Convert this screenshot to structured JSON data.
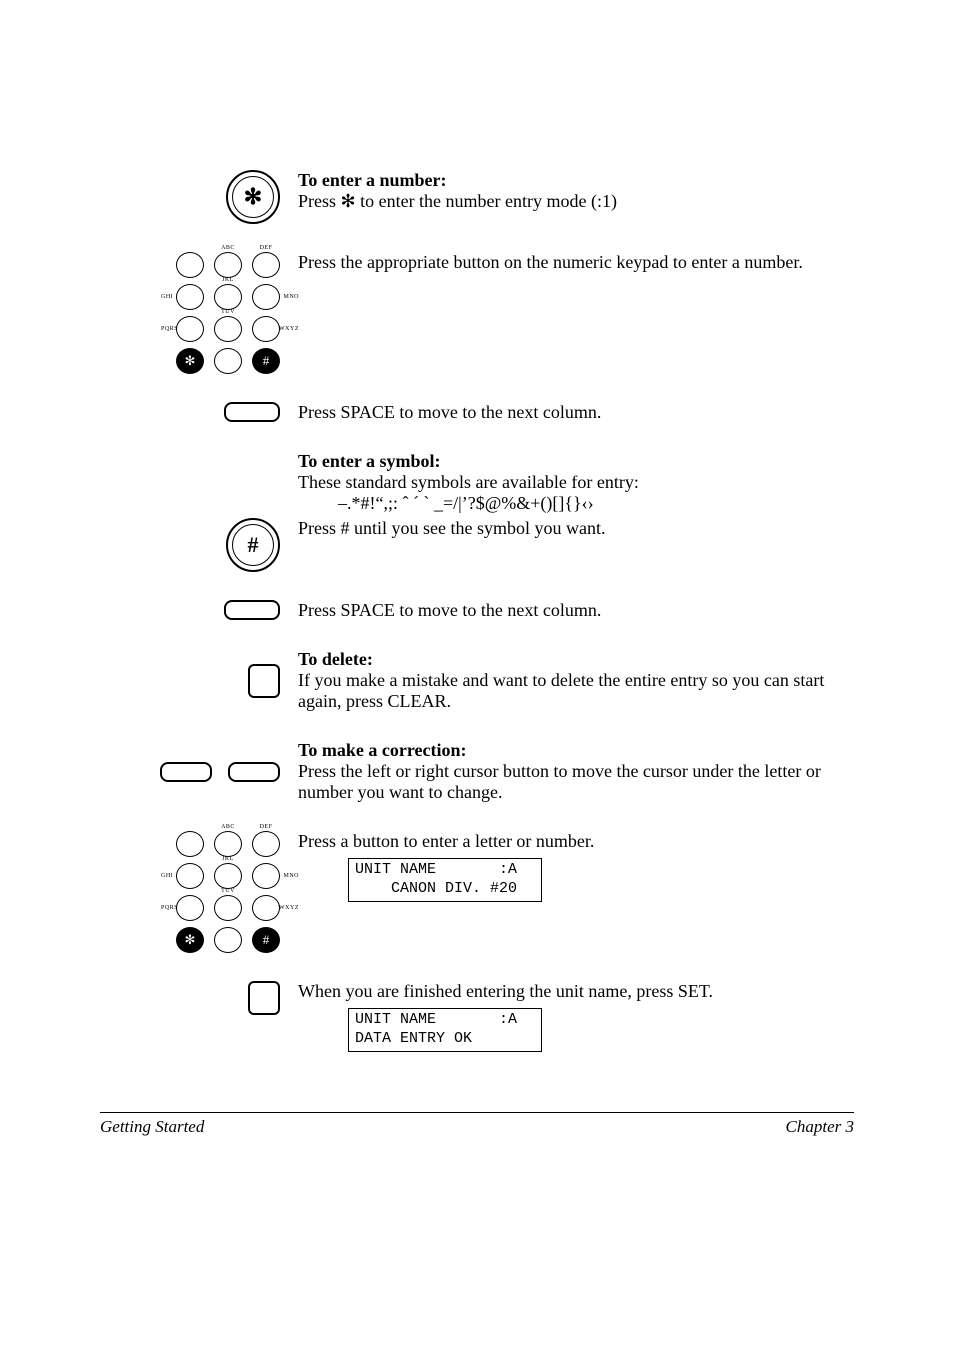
{
  "sections": {
    "number": {
      "heading": "To enter a number:",
      "step1": "Press ✻ to enter the number entry mode (:1)",
      "step2": "Press the appropriate button on the numeric keypad to enter a number.",
      "step3": "Press SPACE to move to the next column."
    },
    "symbol": {
      "heading": "To enter a symbol:",
      "intro": "These standard symbols are available for entry:",
      "symbols": "–.*#!“,;: ˆ ´ ` _=/|’?$@%&+()[]{}‹›",
      "step1": "Press # until you see the symbol you want.",
      "step2": "Press SPACE to move to the next column."
    },
    "delete": {
      "heading": "To delete:",
      "text": "If you make a mistake and want to delete the entire entry so you can start again, press CLEAR."
    },
    "correction": {
      "heading": "To make a correction:",
      "step1": "Press the left or right cursor button to move the cursor under the letter or number you want to change.",
      "step2": "Press a button to enter a letter or number.",
      "step3": "When you are finished entering the unit name, press SET."
    }
  },
  "keypad_labels": {
    "r1c2_top": "ABC",
    "r1c3_top": "DEF",
    "r2c1_left": "GHI",
    "r2c2_top": "JKL",
    "r2c3_right": "MNO",
    "r3c1_left": "PQRS",
    "r3c2_top": "TUV",
    "r3c3_right": "WXYZ",
    "star": "✻",
    "hash": "#"
  },
  "lcd1": {
    "line1": "UNIT NAME       :A",
    "line2": "    CANON DIV. #20"
  },
  "lcd2": {
    "line1": "UNIT NAME       :A",
    "line2": "DATA ENTRY OK"
  },
  "footer": {
    "left": "Getting Started",
    "right": "Chapter 3"
  }
}
